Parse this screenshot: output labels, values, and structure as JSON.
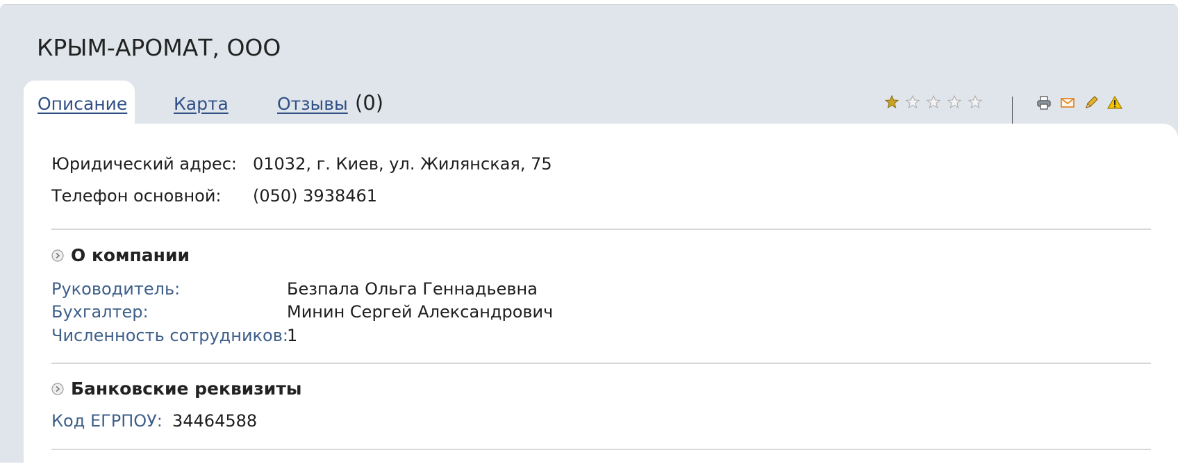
{
  "company": {
    "title": "КРЫМ-АРОМАТ, ООО"
  },
  "tabs": [
    {
      "label": "Описание",
      "active": true
    },
    {
      "label": "Карта",
      "active": false
    },
    {
      "label": "Отзывы",
      "active": false
    }
  ],
  "reviews": {
    "count_text": "(0)"
  },
  "rating": {
    "value": 1,
    "max": 5,
    "filled_color": "#c9a227",
    "empty_color": "#bdbdbd"
  },
  "toolbar": {
    "icons": [
      "printer-icon",
      "mail-icon",
      "pencil-icon",
      "warning-icon"
    ]
  },
  "contacts": {
    "address_label": "Юридический адрес:",
    "address_value": "01032, г. Киев, ул. Жилянская, 75",
    "phone_label": "Телефон основной:",
    "phone_value": "(050) 3938461"
  },
  "about": {
    "title": "О компании",
    "director_label": "Руководитель:",
    "director_value": "Безпала Ольга Геннадьевна",
    "accountant_label": "Бухгалтер:",
    "accountant_value": "Минин Сергей Александрович",
    "staff_label": "Численность сотрудников:",
    "staff_value": "1"
  },
  "bank": {
    "title": "Банковские реквизиты",
    "code_label": "Код ЕГРПОУ:",
    "code_value": "34464588"
  },
  "colors": {
    "frame_bg": "#dfe5eb",
    "link": "#2f4f85",
    "label": "#3e5f8a"
  }
}
